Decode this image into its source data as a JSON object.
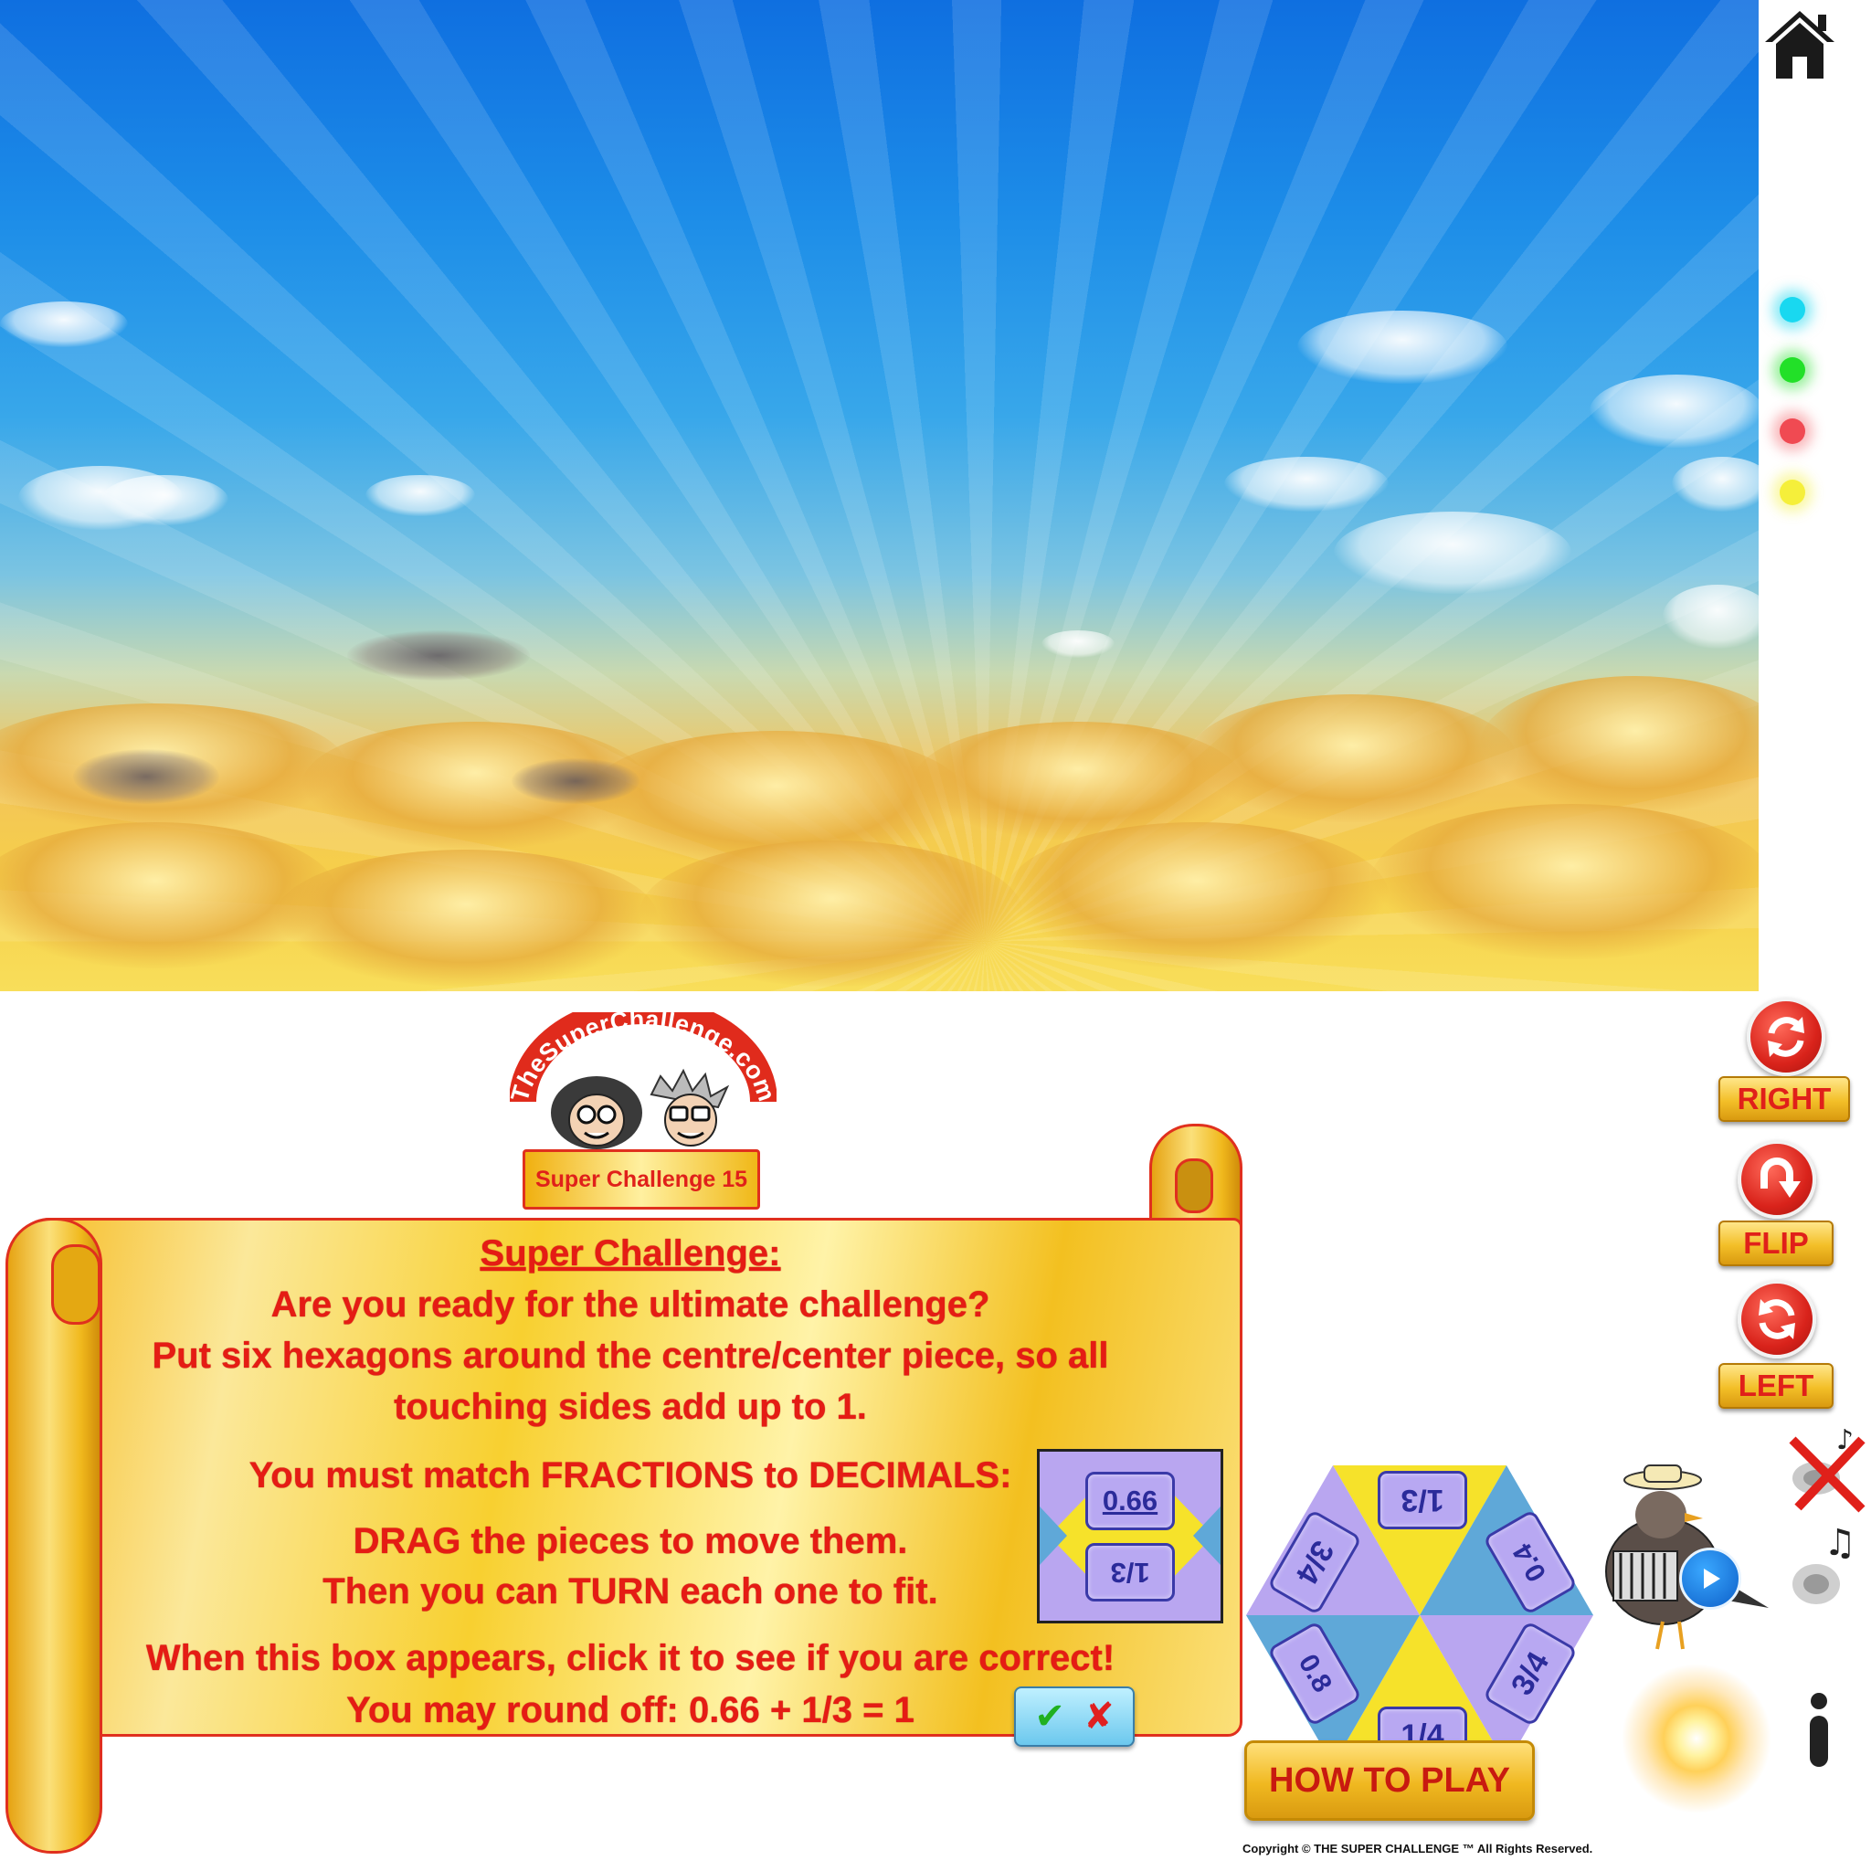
{
  "logo": {
    "text": "TheSuperChallenge.com"
  },
  "title_tab": {
    "label": "Super Challenge 15"
  },
  "instructions": {
    "heading": "Super Challenge:",
    "line1": "Are you ready for the ultimate challenge?",
    "line2": "Put six hexagons around the centre/center piece, so all",
    "line3": "touching sides add up to 1.",
    "line4": "You must match FRACTIONS to DECIMALS:",
    "line5": "DRAG the pieces to move them.",
    "line6": "Then you can TURN each one to fit.",
    "line7": "When this box appears, click it to see if you are correct!",
    "line8": "You may round off:  0.66 + 1/3 = 1"
  },
  "example": {
    "top_tile": "0.66",
    "bottom_tile": "1/3"
  },
  "check_box": {
    "check": "✔",
    "cross": "✘"
  },
  "controls": {
    "right_label": "RIGHT",
    "flip_label": "FLIP",
    "left_label": "LEFT"
  },
  "hexagon": {
    "tiles": [
      "1/3",
      "0.4",
      "3/4",
      "1/4",
      "0.8",
      "3/4"
    ],
    "colors": {
      "purple": "#b9a6f0",
      "yellow": "#f6e22a",
      "blue": "#5fa8d8"
    }
  },
  "how_to_play": {
    "label": "HOW TO PLAY"
  },
  "copyright": {
    "text": "Copyright © THE SUPER CHALLENGE ™ All Rights Reserved."
  },
  "indicator_colors": [
    "#19d8f0",
    "#22e028",
    "#f04a52",
    "#f5ef3a"
  ],
  "info": {
    "glyph": "i"
  }
}
